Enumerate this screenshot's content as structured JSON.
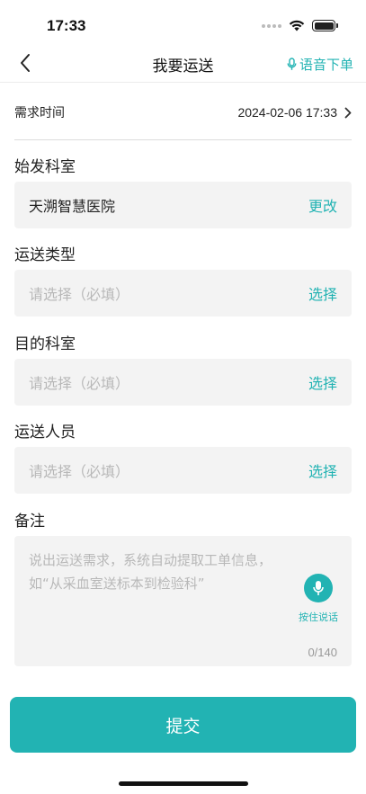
{
  "status_bar": {
    "time": "17:33"
  },
  "nav": {
    "title": "我要运送",
    "voice_order_label": "语音下单"
  },
  "request_time": {
    "label": "需求时间",
    "value": "2024-02-06 17:33"
  },
  "origin_dept": {
    "label": "始发科室",
    "value": "天溯智慧医院",
    "action": "更改"
  },
  "transport_type": {
    "label": "运送类型",
    "placeholder": "请选择（必填）",
    "action": "选择"
  },
  "destination_dept": {
    "label": "目的科室",
    "placeholder": "请选择（必填）",
    "action": "选择"
  },
  "transport_staff": {
    "label": "运送人员",
    "placeholder": "请选择（必填）",
    "action": "选择"
  },
  "remark": {
    "label": "备注",
    "placeholder": "说出运送需求，系统自动提取工单信息，如“从采血室送标本到检验科”",
    "mic_label": "按住说话",
    "char_count": "0/140"
  },
  "submit_label": "提交",
  "colors": {
    "accent": "#22b3b3",
    "field_bg": "#f3f3f3",
    "placeholder": "#b8b8b8"
  }
}
